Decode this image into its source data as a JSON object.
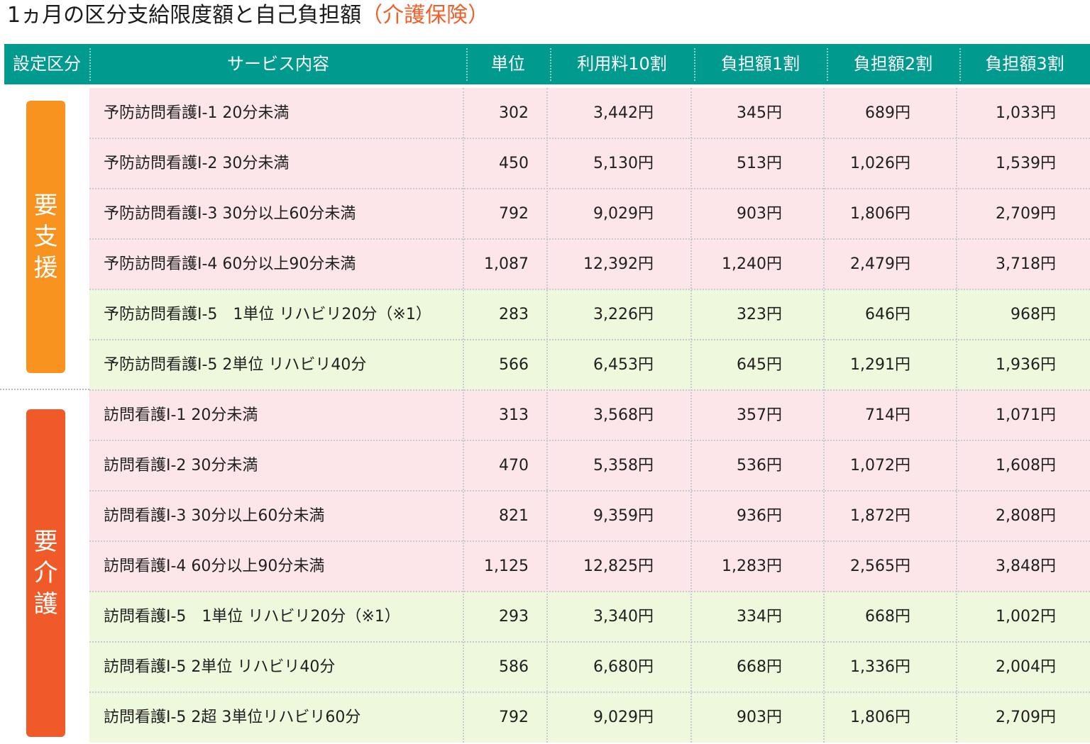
{
  "title": {
    "main": "1ヵ月の区分支給限度額と自己負担額",
    "accent": "（介護保険）"
  },
  "header": {
    "category": "設定区分",
    "service": "サービス内容",
    "unit": "単位",
    "fee10": "利用料10割",
    "burden1": "負担額1割",
    "burden2": "負担額2割",
    "burden3": "負担額3割"
  },
  "groups": [
    {
      "label": "要支援",
      "chars": [
        "要",
        "支",
        "援"
      ],
      "color": "#f7931e"
    },
    {
      "label": "要介護",
      "chars": [
        "要",
        "介",
        "護"
      ],
      "color": "#f05a28"
    }
  ],
  "rows": [
    {
      "group": "要支援",
      "shade": "pink",
      "service": "予防訪問看護Ⅰ-1 20分未満",
      "unit": "302",
      "fee10": "3,442円",
      "burden1": "345円",
      "burden2": "689円",
      "burden3": "1,033円"
    },
    {
      "group": "要支援",
      "shade": "pink",
      "service": "予防訪問看護Ⅰ-2 30分未満",
      "unit": "450",
      "fee10": "5,130円",
      "burden1": "513円",
      "burden2": "1,026円",
      "burden3": "1,539円"
    },
    {
      "group": "要支援",
      "shade": "pink",
      "service": "予防訪問看護Ⅰ-3 30分以上60分未満",
      "unit": "792",
      "fee10": "9,029円",
      "burden1": "903円",
      "burden2": "1,806円",
      "burden3": "2,709円"
    },
    {
      "group": "要支援",
      "shade": "pink",
      "service": "予防訪問看護Ⅰ-4 60分以上90分未満",
      "unit": "1,087",
      "fee10": "12,392円",
      "burden1": "1,240円",
      "burden2": "2,479円",
      "burden3": "3,718円"
    },
    {
      "group": "要支援",
      "shade": "green",
      "service": "予防訪問看護Ⅰ-5　1単位 リハビリ20分（※1）",
      "unit": "283",
      "fee10": "3,226円",
      "burden1": "323円",
      "burden2": "646円",
      "burden3": "968円"
    },
    {
      "group": "要支援",
      "shade": "green",
      "service": "予防訪問看護Ⅰ-5 2単位 リハビリ40分",
      "unit": "566",
      "fee10": "6,453円",
      "burden1": "645円",
      "burden2": "1,291円",
      "burden3": "1,936円"
    },
    {
      "group": "要介護",
      "shade": "pink",
      "service": "訪問看護Ⅰ-1 20分未満",
      "unit": "313",
      "fee10": "3,568円",
      "burden1": "357円",
      "burden2": "714円",
      "burden3": "1,071円"
    },
    {
      "group": "要介護",
      "shade": "pink",
      "service": "訪問看護Ⅰ-2 30分未満",
      "unit": "470",
      "fee10": "5,358円",
      "burden1": "536円",
      "burden2": "1,072円",
      "burden3": "1,608円"
    },
    {
      "group": "要介護",
      "shade": "pink",
      "service": "訪問看護Ⅰ-3 30分以上60分未満",
      "unit": "821",
      "fee10": "9,359円",
      "burden1": "936円",
      "burden2": "1,872円",
      "burden3": "2,808円"
    },
    {
      "group": "要介護",
      "shade": "pink",
      "service": "訪問看護Ⅰ-4 60分以上90分未満",
      "unit": "1,125",
      "fee10": "12,825円",
      "burden1": "1,283円",
      "burden2": "2,565円",
      "burden3": "3,848円"
    },
    {
      "group": "要介護",
      "shade": "green",
      "service": "訪問看護Ⅰ-5　1単位 リハビリ20分（※1）",
      "unit": "293",
      "fee10": "3,340円",
      "burden1": "334円",
      "burden2": "668円",
      "burden3": "1,002円"
    },
    {
      "group": "要介護",
      "shade": "green",
      "service": "訪問看護Ⅰ-5 2単位 リハビリ40分",
      "unit": "586",
      "fee10": "6,680円",
      "burden1": "668円",
      "burden2": "1,336円",
      "burden3": "2,004円"
    },
    {
      "group": "要介護",
      "shade": "green",
      "service": "訪問看護Ⅰ-5 2超 3単位リハビリ60分",
      "unit": "792",
      "fee10": "9,029円",
      "burden1": "903円",
      "burden2": "1,806円",
      "burden3": "2,709円"
    }
  ],
  "colors": {
    "header_bg": "#009a8e",
    "row_pink": "#fde6ea",
    "row_green": "#eef8dd",
    "title_accent": "#f0602a"
  }
}
